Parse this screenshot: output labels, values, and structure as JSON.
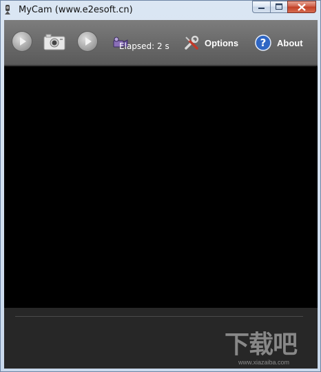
{
  "window": {
    "title": "MyCam (www.e2esoft.cn)"
  },
  "toolbar": {
    "elapsed": "Elapsed: 2 s",
    "options_label": "Options",
    "about_label": "About"
  },
  "watermark": {
    "text": "下载吧",
    "sub": "www.xiazaiba.com"
  },
  "colors": {
    "toolbar": "#6e6e6e",
    "video_area": "#000000",
    "bottom_panel": "#272727",
    "about_icon": "#2f66c4",
    "close_button": "#c94a30"
  },
  "icons": [
    "app-icon",
    "play-icon",
    "camera-icon",
    "record-icon",
    "video-camera-icon",
    "tools-icon",
    "help-icon"
  ]
}
